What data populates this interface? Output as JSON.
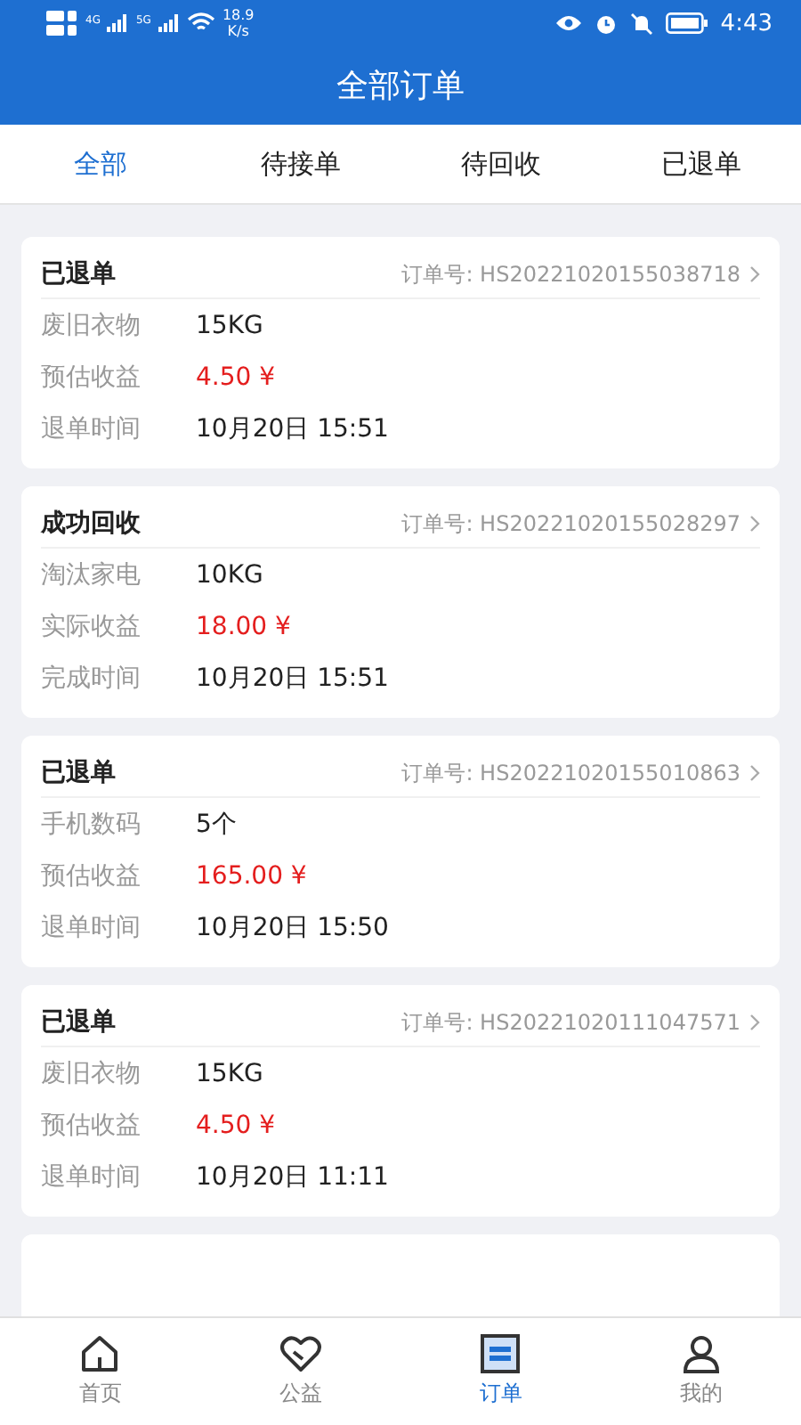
{
  "status_bar": {
    "network_1": "4G",
    "network_2": "5G",
    "speed": "18.9",
    "speed_unit": "K/s",
    "time": "4:43"
  },
  "header": {
    "title": "全部订单"
  },
  "tabs": [
    {
      "label": "全部",
      "selected": true
    },
    {
      "label": "待接单",
      "selected": false
    },
    {
      "label": "待回收",
      "selected": false
    },
    {
      "label": "已退单",
      "selected": false
    }
  ],
  "orders": [
    {
      "status": "已退单",
      "order_no": "订单号: HS20221020155038718",
      "rows": [
        {
          "label": "废旧衣物",
          "value": "15KG",
          "kind": "text"
        },
        {
          "label": "预估收益",
          "value": "4.50 ¥",
          "kind": "money"
        },
        {
          "label": "退单时间",
          "value": "10月20日 15:51",
          "kind": "text"
        }
      ]
    },
    {
      "status": "成功回收",
      "order_no": "订单号: HS20221020155028297",
      "rows": [
        {
          "label": "淘汰家电",
          "value": "10KG",
          "kind": "text"
        },
        {
          "label": "实际收益",
          "value": "18.00 ¥",
          "kind": "money"
        },
        {
          "label": "完成时间",
          "value": "10月20日 15:51",
          "kind": "text"
        }
      ]
    },
    {
      "status": "已退单",
      "order_no": "订单号: HS20221020155010863",
      "rows": [
        {
          "label": "手机数码",
          "value": "5个",
          "kind": "text"
        },
        {
          "label": "预估收益",
          "value": "165.00 ¥",
          "kind": "money"
        },
        {
          "label": "退单时间",
          "value": "10月20日 15:50",
          "kind": "text"
        }
      ]
    },
    {
      "status": "已退单",
      "order_no": "订单号: HS20221020111047571",
      "rows": [
        {
          "label": "废旧衣物",
          "value": "15KG",
          "kind": "text"
        },
        {
          "label": "预估收益",
          "value": "4.50 ¥",
          "kind": "money"
        },
        {
          "label": "退单时间",
          "value": "10月20日 11:11",
          "kind": "text"
        }
      ]
    }
  ],
  "bottom_nav": [
    {
      "label": "首页",
      "kind": "home",
      "selected": false
    },
    {
      "label": "公益",
      "kind": "charity",
      "selected": false
    },
    {
      "label": "订单",
      "kind": "orders",
      "selected": true
    },
    {
      "label": "我的",
      "kind": "profile",
      "selected": false
    }
  ]
}
